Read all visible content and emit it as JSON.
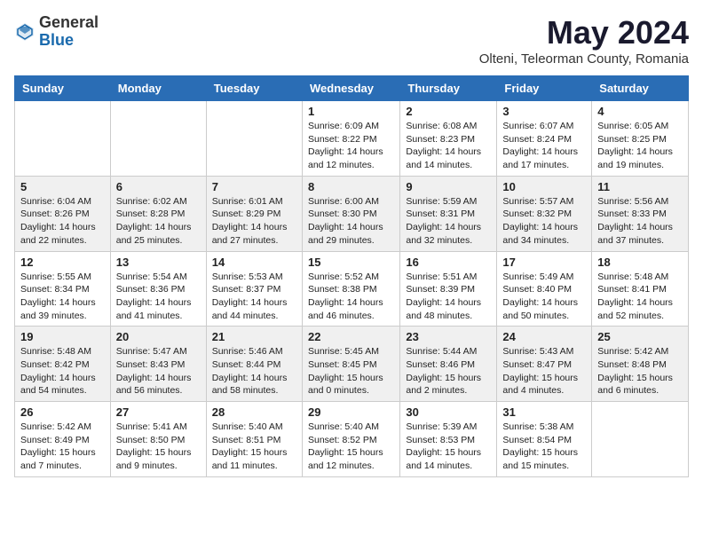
{
  "header": {
    "logo_general": "General",
    "logo_blue": "Blue",
    "month_title": "May 2024",
    "location": "Olteni, Teleorman County, Romania"
  },
  "weekdays": [
    "Sunday",
    "Monday",
    "Tuesday",
    "Wednesday",
    "Thursday",
    "Friday",
    "Saturday"
  ],
  "weeks": [
    [
      {
        "day": "",
        "info": ""
      },
      {
        "day": "",
        "info": ""
      },
      {
        "day": "",
        "info": ""
      },
      {
        "day": "1",
        "info": "Sunrise: 6:09 AM\nSunset: 8:22 PM\nDaylight: 14 hours\nand 12 minutes."
      },
      {
        "day": "2",
        "info": "Sunrise: 6:08 AM\nSunset: 8:23 PM\nDaylight: 14 hours\nand 14 minutes."
      },
      {
        "day": "3",
        "info": "Sunrise: 6:07 AM\nSunset: 8:24 PM\nDaylight: 14 hours\nand 17 minutes."
      },
      {
        "day": "4",
        "info": "Sunrise: 6:05 AM\nSunset: 8:25 PM\nDaylight: 14 hours\nand 19 minutes."
      }
    ],
    [
      {
        "day": "5",
        "info": "Sunrise: 6:04 AM\nSunset: 8:26 PM\nDaylight: 14 hours\nand 22 minutes."
      },
      {
        "day": "6",
        "info": "Sunrise: 6:02 AM\nSunset: 8:28 PM\nDaylight: 14 hours\nand 25 minutes."
      },
      {
        "day": "7",
        "info": "Sunrise: 6:01 AM\nSunset: 8:29 PM\nDaylight: 14 hours\nand 27 minutes."
      },
      {
        "day": "8",
        "info": "Sunrise: 6:00 AM\nSunset: 8:30 PM\nDaylight: 14 hours\nand 29 minutes."
      },
      {
        "day": "9",
        "info": "Sunrise: 5:59 AM\nSunset: 8:31 PM\nDaylight: 14 hours\nand 32 minutes."
      },
      {
        "day": "10",
        "info": "Sunrise: 5:57 AM\nSunset: 8:32 PM\nDaylight: 14 hours\nand 34 minutes."
      },
      {
        "day": "11",
        "info": "Sunrise: 5:56 AM\nSunset: 8:33 PM\nDaylight: 14 hours\nand 37 minutes."
      }
    ],
    [
      {
        "day": "12",
        "info": "Sunrise: 5:55 AM\nSunset: 8:34 PM\nDaylight: 14 hours\nand 39 minutes."
      },
      {
        "day": "13",
        "info": "Sunrise: 5:54 AM\nSunset: 8:36 PM\nDaylight: 14 hours\nand 41 minutes."
      },
      {
        "day": "14",
        "info": "Sunrise: 5:53 AM\nSunset: 8:37 PM\nDaylight: 14 hours\nand 44 minutes."
      },
      {
        "day": "15",
        "info": "Sunrise: 5:52 AM\nSunset: 8:38 PM\nDaylight: 14 hours\nand 46 minutes."
      },
      {
        "day": "16",
        "info": "Sunrise: 5:51 AM\nSunset: 8:39 PM\nDaylight: 14 hours\nand 48 minutes."
      },
      {
        "day": "17",
        "info": "Sunrise: 5:49 AM\nSunset: 8:40 PM\nDaylight: 14 hours\nand 50 minutes."
      },
      {
        "day": "18",
        "info": "Sunrise: 5:48 AM\nSunset: 8:41 PM\nDaylight: 14 hours\nand 52 minutes."
      }
    ],
    [
      {
        "day": "19",
        "info": "Sunrise: 5:48 AM\nSunset: 8:42 PM\nDaylight: 14 hours\nand 54 minutes."
      },
      {
        "day": "20",
        "info": "Sunrise: 5:47 AM\nSunset: 8:43 PM\nDaylight: 14 hours\nand 56 minutes."
      },
      {
        "day": "21",
        "info": "Sunrise: 5:46 AM\nSunset: 8:44 PM\nDaylight: 14 hours\nand 58 minutes."
      },
      {
        "day": "22",
        "info": "Sunrise: 5:45 AM\nSunset: 8:45 PM\nDaylight: 15 hours\nand 0 minutes."
      },
      {
        "day": "23",
        "info": "Sunrise: 5:44 AM\nSunset: 8:46 PM\nDaylight: 15 hours\nand 2 minutes."
      },
      {
        "day": "24",
        "info": "Sunrise: 5:43 AM\nSunset: 8:47 PM\nDaylight: 15 hours\nand 4 minutes."
      },
      {
        "day": "25",
        "info": "Sunrise: 5:42 AM\nSunset: 8:48 PM\nDaylight: 15 hours\nand 6 minutes."
      }
    ],
    [
      {
        "day": "26",
        "info": "Sunrise: 5:42 AM\nSunset: 8:49 PM\nDaylight: 15 hours\nand 7 minutes."
      },
      {
        "day": "27",
        "info": "Sunrise: 5:41 AM\nSunset: 8:50 PM\nDaylight: 15 hours\nand 9 minutes."
      },
      {
        "day": "28",
        "info": "Sunrise: 5:40 AM\nSunset: 8:51 PM\nDaylight: 15 hours\nand 11 minutes."
      },
      {
        "day": "29",
        "info": "Sunrise: 5:40 AM\nSunset: 8:52 PM\nDaylight: 15 hours\nand 12 minutes."
      },
      {
        "day": "30",
        "info": "Sunrise: 5:39 AM\nSunset: 8:53 PM\nDaylight: 15 hours\nand 14 minutes."
      },
      {
        "day": "31",
        "info": "Sunrise: 5:38 AM\nSunset: 8:54 PM\nDaylight: 15 hours\nand 15 minutes."
      },
      {
        "day": "",
        "info": ""
      }
    ]
  ]
}
